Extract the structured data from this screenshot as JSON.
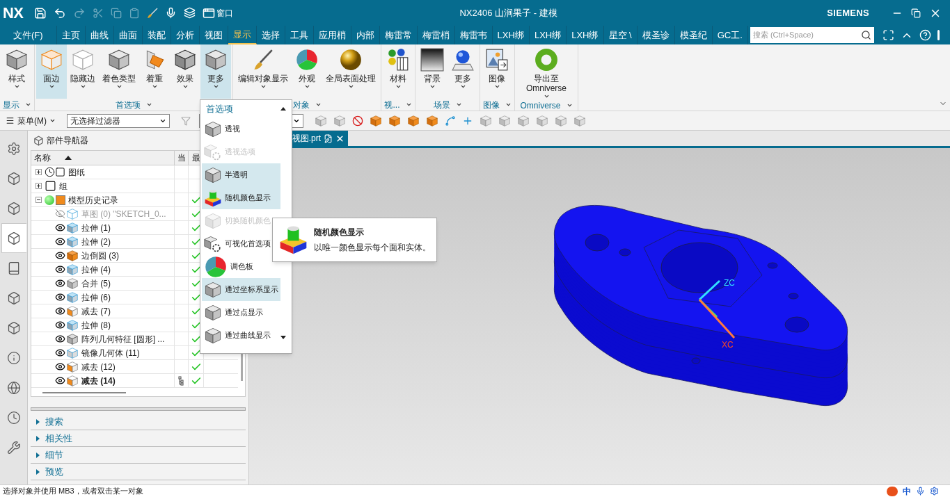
{
  "title_bar": {
    "logo": "NX",
    "window_menu": "窗口",
    "title": "NX2406 山涧果子 - 建模",
    "brand": "SIEMENS"
  },
  "menu_tabs": [
    {
      "label": "文件(F)",
      "selected": false
    },
    {
      "label": "主页",
      "selected": false
    },
    {
      "label": "曲线",
      "selected": false
    },
    {
      "label": "曲面",
      "selected": false
    },
    {
      "label": "装配",
      "selected": false
    },
    {
      "label": "分析",
      "selected": false
    },
    {
      "label": "视图",
      "selected": false
    },
    {
      "label": "显示",
      "selected": true
    },
    {
      "label": "选择",
      "selected": false
    },
    {
      "label": "工具",
      "selected": false
    },
    {
      "label": "应用梢",
      "selected": false
    },
    {
      "label": "内部",
      "selected": false
    },
    {
      "label": "梅雷常",
      "selected": false
    },
    {
      "label": "梅雷梢",
      "selected": false
    },
    {
      "label": "梅雷韦",
      "selected": false
    },
    {
      "label": "LXH绑",
      "selected": false
    },
    {
      "label": "LXH绑",
      "selected": false
    },
    {
      "label": "LXH绑",
      "selected": false
    },
    {
      "label": "星空 \\",
      "selected": false
    },
    {
      "label": "模圣诊",
      "selected": false
    },
    {
      "label": "模圣纪",
      "selected": false
    },
    {
      "label": "GC工.",
      "selected": false
    }
  ],
  "search": {
    "placeholder": "搜索 (Ctrl+Space)"
  },
  "ribbon": [
    {
      "label": "显示",
      "buttons": [
        {
          "label": "样式",
          "kind": "cube",
          "selected": false
        }
      ]
    },
    {
      "label": "首选项",
      "buttons": [
        {
          "label": "面边",
          "kind": "cube-orange",
          "selected": true
        },
        {
          "label": "隐藏边",
          "kind": "cube-wire",
          "selected": false
        },
        {
          "label": "着色类型",
          "kind": "cube",
          "selected": false
        },
        {
          "label": "着重",
          "kind": "panes",
          "selected": false
        },
        {
          "label": "效果",
          "kind": "cube-facets",
          "selected": false
        },
        {
          "label": "更多",
          "kind": "cube",
          "selected": true
        }
      ]
    },
    {
      "label": "对象",
      "buttons": [
        {
          "label": "编辑对象显示",
          "kind": "brush",
          "selected": false
        },
        {
          "label": "外观",
          "kind": "pie",
          "selected": false
        },
        {
          "label": "全局表面处理",
          "kind": "gold-sphere",
          "selected": false
        }
      ]
    },
    {
      "label": "视...",
      "buttons": [
        {
          "label": "材料",
          "kind": "balls",
          "selected": false
        }
      ]
    },
    {
      "label": "场景",
      "buttons": [
        {
          "label": "背景",
          "kind": "gradient",
          "selected": false
        },
        {
          "label": "更多",
          "kind": "blue-sphere",
          "selected": false
        }
      ]
    },
    {
      "label": "图像",
      "buttons": [
        {
          "label": "图像",
          "kind": "image",
          "selected": false
        }
      ]
    },
    {
      "label": "Omniverse",
      "buttons": [
        {
          "label": "导出至 Omniverse",
          "kind": "ring",
          "selected": false
        }
      ]
    }
  ],
  "toolbar": {
    "menu": "菜单(M)",
    "filter": "无选择过滤器"
  },
  "rail": [
    {
      "selected": false
    },
    {
      "selected": false
    },
    {
      "selected": false
    },
    {
      "selected": true
    },
    {
      "selected": false
    },
    {
      "selected": false
    },
    {
      "selected": false
    },
    {
      "selected": false
    },
    {
      "selected": false
    },
    {
      "selected": false
    },
    {
      "selected": false
    }
  ],
  "navigator": {
    "title": "部件导航器",
    "columns": [
      "名称",
      "当",
      "最"
    ],
    "tree": [
      {
        "label": "图纸",
        "kind": "drawing",
        "expanded": false
      },
      {
        "label": "组",
        "kind": "group",
        "expanded": false
      },
      {
        "label": "模型历史记录",
        "kind": "history",
        "expanded": true,
        "up_to_date": true,
        "children": [
          {
            "label": "草图 (0) \"SKETCH_0...",
            "kind": "sketch",
            "visible": false,
            "current": false,
            "up_to_date": true
          },
          {
            "label": "拉伸 (1)",
            "kind": "extrude",
            "visible": true,
            "current": false,
            "up_to_date": true
          },
          {
            "label": "拉伸 (2)",
            "kind": "extrude",
            "visible": true,
            "current": false,
            "up_to_date": true
          },
          {
            "label": "边倒圆 (3)",
            "kind": "blend",
            "visible": true,
            "current": false,
            "up_to_date": true
          },
          {
            "label": "拉伸 (4)",
            "kind": "extrude",
            "visible": true,
            "current": false,
            "up_to_date": true
          },
          {
            "label": "合并 (5)",
            "kind": "unite",
            "visible": true,
            "current": false,
            "up_to_date": true
          },
          {
            "label": "拉伸 (6)",
            "kind": "extrude",
            "visible": true,
            "current": false,
            "up_to_date": true
          },
          {
            "label": "减去 (7)",
            "kind": "subtract",
            "visible": true,
            "current": false,
            "up_to_date": true
          },
          {
            "label": "拉伸 (8)",
            "kind": "extrude",
            "visible": true,
            "current": false,
            "up_to_date": true
          },
          {
            "label": "阵列几何特征 [圆形] ...",
            "kind": "pattern",
            "visible": true,
            "current": false,
            "up_to_date": true
          },
          {
            "label": "镜像几何体 (11)",
            "kind": "mirror",
            "visible": true,
            "current": false,
            "up_to_date": true
          },
          {
            "label": "减去 (12)",
            "kind": "subtract",
            "visible": true,
            "current": false,
            "up_to_date": true
          },
          {
            "label": "减去 (14)",
            "kind": "subtract",
            "visible": true,
            "current": true,
            "up_to_date": true
          }
        ]
      }
    ],
    "sections": [
      {
        "label": "搜索",
        "expanded": false
      },
      {
        "label": "相关性",
        "expanded": false
      },
      {
        "label": "细节",
        "expanded": false
      },
      {
        "label": "预览",
        "expanded": false
      }
    ]
  },
  "viewport": {
    "tab": "视图.prt",
    "axes": [
      "ZC",
      "XC"
    ]
  },
  "dropdown": {
    "title": "首选项",
    "items": [
      {
        "label": "透视",
        "kind": "cube",
        "disabled": false,
        "on": false
      },
      {
        "label": "透视选项",
        "kind": "cube-gear",
        "disabled": true,
        "on": false
      },
      {
        "label": "半透明",
        "kind": "cube",
        "disabled": false,
        "on": true
      },
      {
        "label": "随机颜色显示",
        "kind": "random",
        "disabled": false,
        "on": true
      },
      {
        "label": "切换随机颜色",
        "kind": "cube",
        "disabled": true,
        "on": false
      },
      {
        "label": "可视化首选项",
        "kind": "cube-gear",
        "disabled": false,
        "on": false
      },
      {
        "label": "调色板",
        "kind": "pie",
        "disabled": false,
        "on": false
      },
      {
        "label": "通过坐标系显示",
        "kind": "cube",
        "disabled": false,
        "on": true
      },
      {
        "label": "通过点显示",
        "kind": "cube",
        "disabled": false,
        "on": false
      },
      {
        "label": "通过曲线显示",
        "kind": "cube",
        "disabled": false,
        "on": false
      }
    ]
  },
  "tooltip": {
    "title": "随机颜色显示",
    "text": "以唯一颜色显示每个面和实体。"
  },
  "status_bar": {
    "message": "选择对象并使用 MB3，或者双击某一对象",
    "ime": "中"
  }
}
